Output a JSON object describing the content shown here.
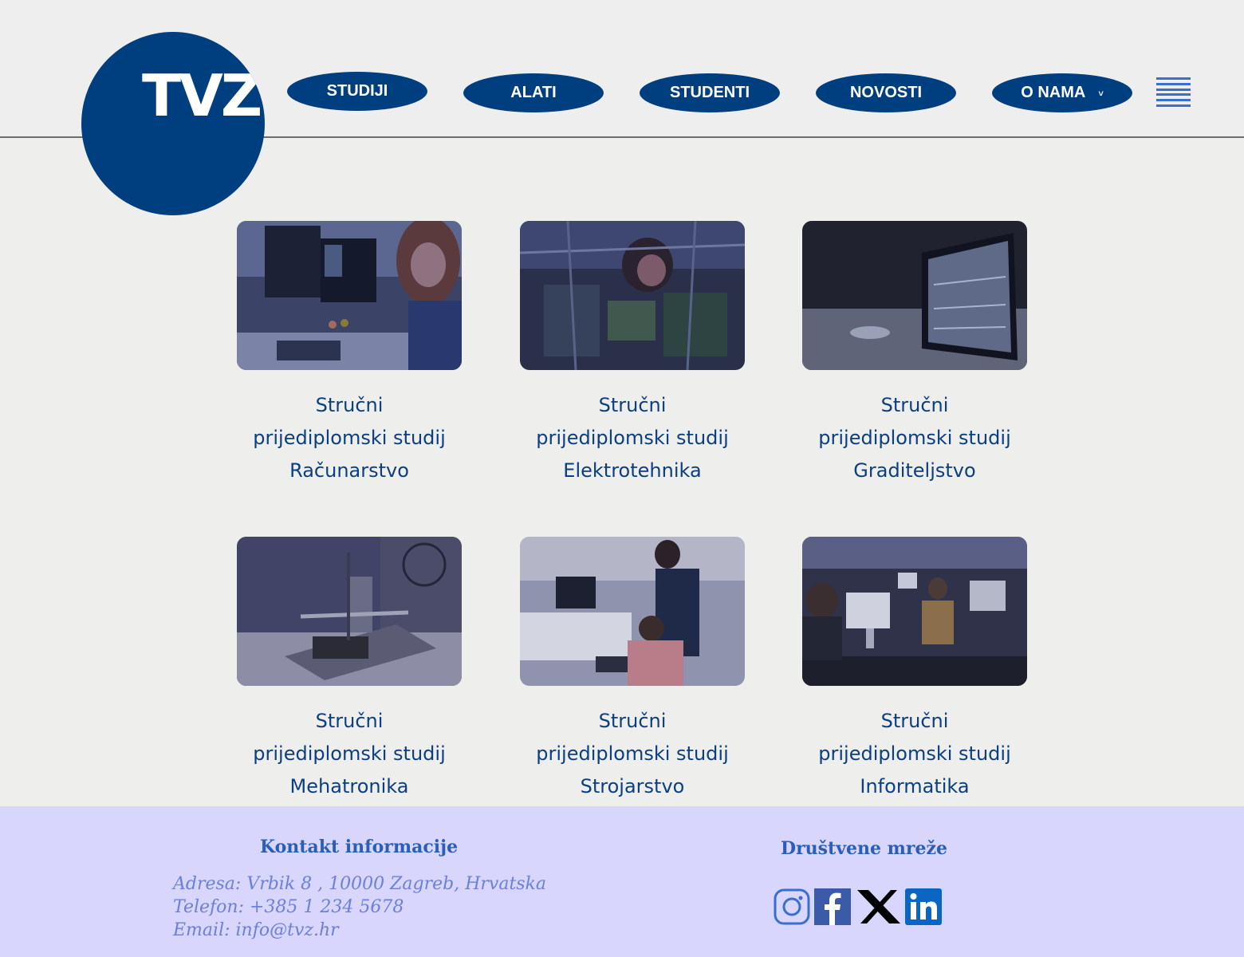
{
  "logo": {
    "text": "TVZ"
  },
  "nav": {
    "items": [
      {
        "label": "STUDIJI"
      },
      {
        "label": "ALATI"
      },
      {
        "label": "STUDENTI"
      },
      {
        "label": "NOVOSTI"
      },
      {
        "label": "O NAMA",
        "chevron": "˅"
      }
    ]
  },
  "cards": [
    {
      "line1": "Stručni",
      "line2": "prijediplomski studij",
      "line3": "Računarstvo",
      "image": "woman-at-computer-monitors"
    },
    {
      "line1": "Stručni",
      "line2": "prijediplomski studij",
      "line3": "Elektrotehnika",
      "image": "student-behind-electronics"
    },
    {
      "line1": "Stručni",
      "line2": "prijediplomski studij",
      "line3": "Graditeljstvo",
      "image": "cad-drawing-on-monitor"
    },
    {
      "line1": "Stručni",
      "line2": "prijediplomski studij",
      "line3": "Mehatronika",
      "image": "cnc-machine-model"
    },
    {
      "line1": "Stručni",
      "line2": "prijediplomski studij",
      "line3": "Strojarstvo",
      "image": "students-in-lab"
    },
    {
      "line1": "Stručni",
      "line2": "prijediplomski studij",
      "line3": "Informatika",
      "image": "computer-classroom"
    }
  ],
  "footer": {
    "contact": {
      "heading": "Kontakt informacije",
      "address": "Adresa: Vrbik 8 , 10000 Zagreb, Hrvatska",
      "phone": "Telefon: +385 1 234 5678",
      "email": "Email: info@tvz.hr"
    },
    "social": {
      "heading": "Društvene mreže",
      "icons": [
        "instagram-icon",
        "facebook-icon",
        "x-icon",
        "linkedin-icon"
      ]
    }
  },
  "colors": {
    "brand": "#003f7f",
    "card_title": "#0b3f80",
    "footer_bg": "#d8d6fd",
    "footer_heading": "#2a5fb8",
    "footer_text": "#6b80d8"
  }
}
